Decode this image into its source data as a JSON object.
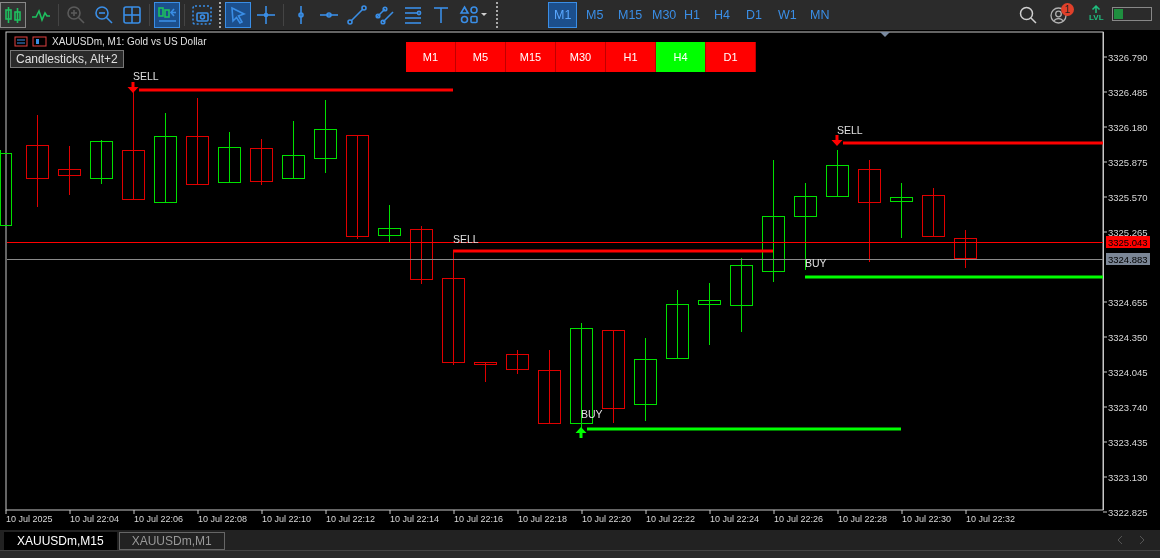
{
  "toolbar": {
    "tools": [
      {
        "kind": "candles",
        "selected": true
      },
      {
        "kind": "line",
        "selected": false
      },
      {
        "kind": "sep"
      },
      {
        "kind": "zoom-in",
        "selected": false,
        "disabled": true
      },
      {
        "kind": "zoom-out",
        "selected": false
      },
      {
        "kind": "grid",
        "selected": false
      },
      {
        "kind": "sep"
      },
      {
        "kind": "autoscroll",
        "selected": true
      },
      {
        "kind": "sep"
      },
      {
        "kind": "screenshot",
        "selected": false
      },
      {
        "kind": "dots"
      },
      {
        "kind": "cursor",
        "selected": true
      },
      {
        "kind": "crosshair",
        "selected": false
      },
      {
        "kind": "sep"
      },
      {
        "kind": "vline",
        "selected": false
      },
      {
        "kind": "hline",
        "selected": false
      },
      {
        "kind": "trend",
        "selected": false
      },
      {
        "kind": "channel",
        "selected": false
      },
      {
        "kind": "fibo",
        "selected": false
      },
      {
        "kind": "text",
        "selected": false
      },
      {
        "kind": "shapes",
        "selected": false
      },
      {
        "kind": "dots"
      }
    ],
    "timeframes": [
      {
        "label": "M1",
        "selected": true
      },
      {
        "label": "M5",
        "selected": false
      },
      {
        "label": "M15",
        "selected": false
      },
      {
        "label": "M30",
        "selected": false
      },
      {
        "label": "H1",
        "selected": false
      },
      {
        "label": "H4",
        "selected": false
      },
      {
        "label": "D1",
        "selected": false
      },
      {
        "label": "W1",
        "selected": false
      },
      {
        "label": "MN",
        "selected": false
      }
    ],
    "notification_count": "1",
    "level_badge": "LVL",
    "level_meter": {
      "level": 0.25
    }
  },
  "chart": {
    "title": "XAUUSDm, M1: Gold vs US Dollar",
    "tooltip": "Candlesticks, Alt+2",
    "panel_buttons": [
      {
        "label": "M1",
        "selected": false
      },
      {
        "label": "M5",
        "selected": false
      },
      {
        "label": "M15",
        "selected": false
      },
      {
        "label": "M30",
        "selected": false
      },
      {
        "label": "H1",
        "selected": false
      },
      {
        "label": "H4",
        "selected": true
      },
      {
        "label": "D1",
        "selected": false
      }
    ],
    "signals": [
      {
        "label": "SELL",
        "kind": "sell"
      },
      {
        "label": "SELL",
        "kind": "sell"
      },
      {
        "label": "SELL",
        "kind": "sell"
      },
      {
        "label": "BUY",
        "kind": "buy"
      },
      {
        "label": "BUY",
        "kind": "buy"
      }
    ],
    "price_ticks": [
      "3326.790",
      "3326.485",
      "3326.180",
      "3325.875",
      "3325.570",
      "3325.265",
      "3324.655",
      "3324.350",
      "3324.045",
      "3323.740",
      "3323.435",
      "3323.130",
      "3322.825"
    ],
    "price_labels": [
      {
        "text": "3325.043",
        "kind": "bid"
      },
      {
        "text": "3324.883",
        "kind": "ask"
      }
    ],
    "time_labels": [
      "10 Jul 2025",
      "10 Jul 22:04",
      "10 Jul 22:06",
      "10 Jul 22:08",
      "10 Jul 22:10",
      "10 Jul 22:12",
      "10 Jul 22:14",
      "10 Jul 22:16",
      "10 Jul 22:18",
      "10 Jul 22:20",
      "10 Jul 22:22",
      "10 Jul 22:24",
      "10 Jul 22:26",
      "10 Jul 22:28",
      "10 Jul 22:30",
      "10 Jul 22:32"
    ]
  },
  "tabs": [
    {
      "label": "XAUUSDm,M15",
      "selected": true
    },
    {
      "label": "XAUUSDm,M1",
      "selected": false
    }
  ]
}
